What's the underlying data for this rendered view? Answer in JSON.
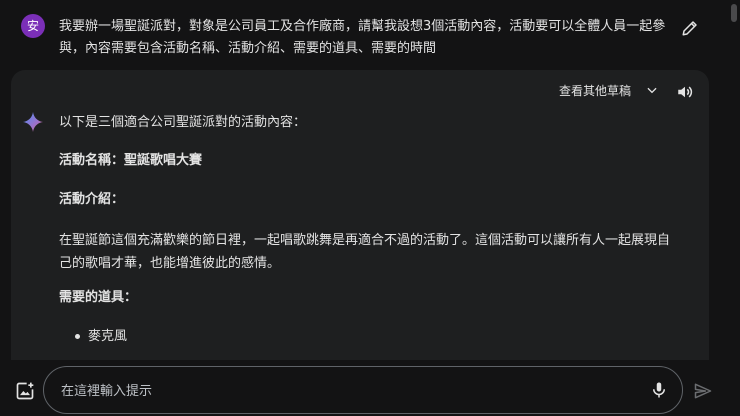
{
  "user_prompt": {
    "avatar_letter": "安",
    "text": "我要辦一場聖誕派對，對象是公司員工及合作廠商，請幫我設想3個活動內容，活動要可以全體人員一起參與，內容需要包含活動名稱、活動介紹、需要的道具、需要的時間"
  },
  "response": {
    "view_drafts_label": "查看其他草稿",
    "intro": "以下是三個適合公司聖誕派對的活動內容：",
    "activity_name": "活動名稱：聖誕歌唱大賽",
    "activity_desc_heading": "活動介紹：",
    "activity_desc": "在聖誕節這個充滿歡樂的節日裡，一起唱歌跳舞是再適合不過的活動了。這個活動可以讓所有人一起展現自己的歌唱才華，也能增進彼此的感情。",
    "tools_heading": "需要的道具：",
    "tools": [
      "麥克風"
    ]
  },
  "input": {
    "placeholder": "在這裡輸入提示"
  },
  "colors": {
    "background": "#131314",
    "card": "#1e1f20",
    "avatar": "#7b2fb8"
  },
  "icons": [
    "edit-icon",
    "chevron-down-icon",
    "speaker-icon",
    "sparkle-icon",
    "add-image-icon",
    "mic-icon",
    "send-icon"
  ]
}
